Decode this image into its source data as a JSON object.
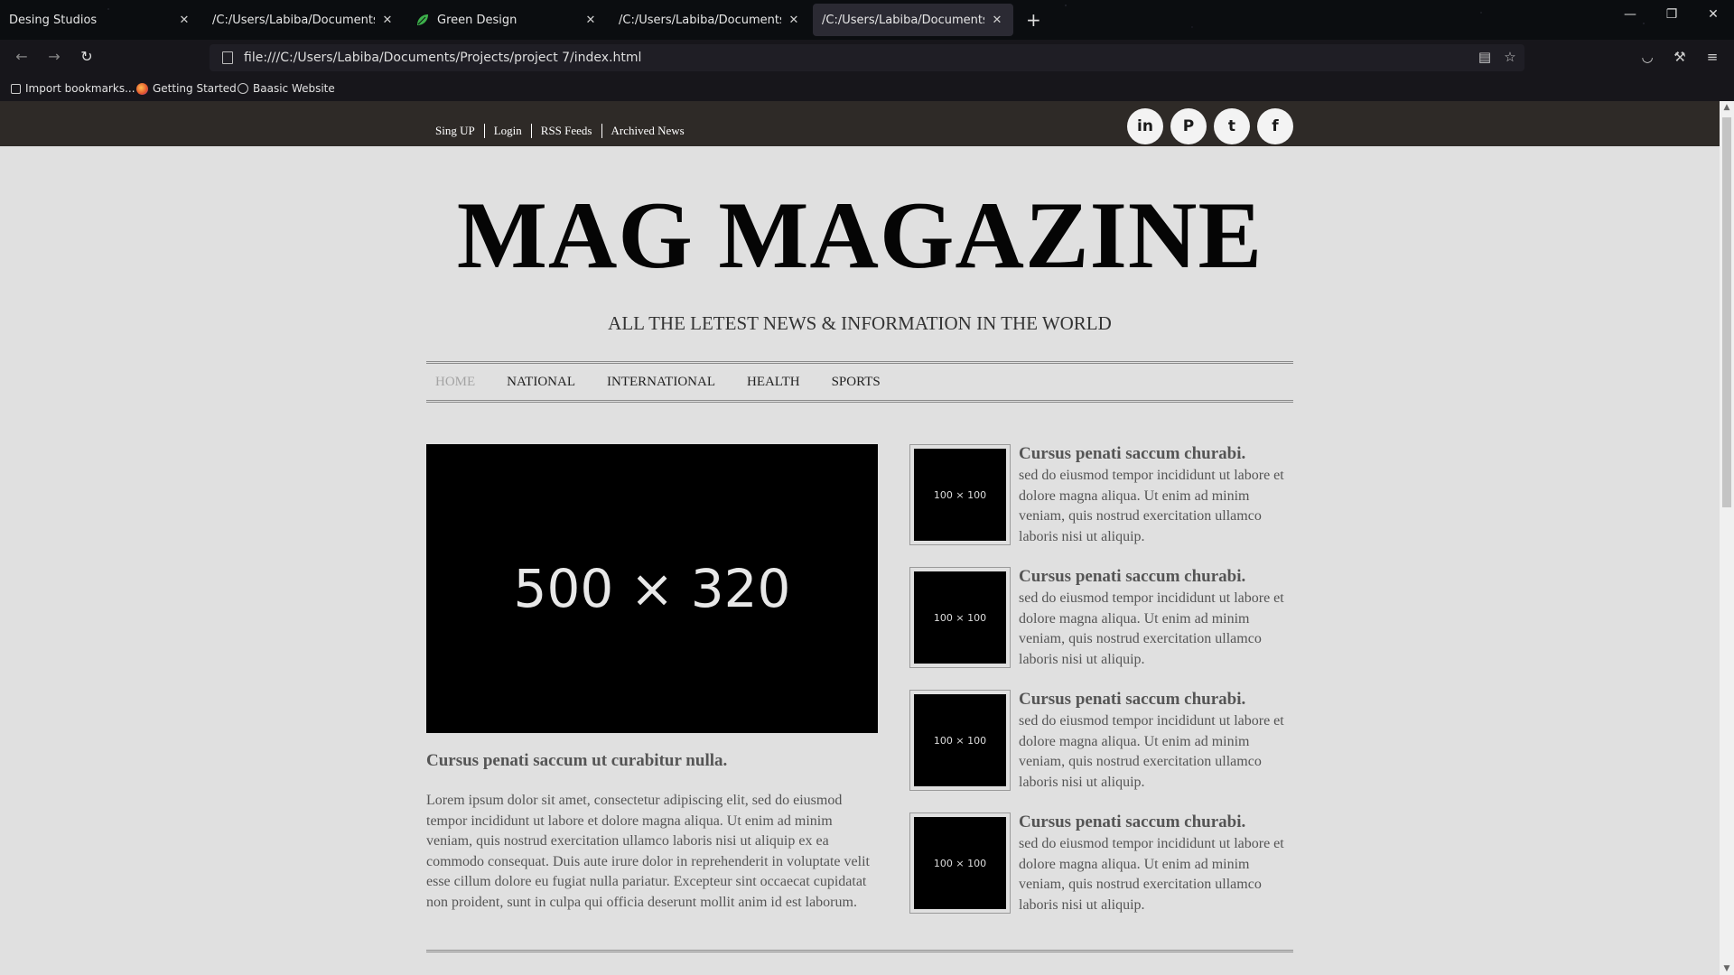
{
  "browser": {
    "tabs": [
      {
        "title": "Desing Studios"
      },
      {
        "title": "/C:/Users/Labiba/Documents/Proje"
      },
      {
        "title": "Green Design"
      },
      {
        "title": "/C:/Users/Labiba/Documents/Proje"
      },
      {
        "title": "/C:/Users/Labiba/Documents/Proje"
      }
    ],
    "url": "file:///C:/Users/Labiba/Documents/Projects/project 7/index.html",
    "bookmarks": [
      {
        "label": "Import bookmarks..."
      },
      {
        "label": "Getting Started"
      },
      {
        "label": "Baasic Website"
      }
    ]
  },
  "site": {
    "top_links": [
      "Sing UP",
      "Login",
      "RSS Feeds",
      "Archived News"
    ],
    "social": [
      {
        "icon": "linkedin-icon",
        "glyph": "in"
      },
      {
        "icon": "pinterest-icon",
        "glyph": "P"
      },
      {
        "icon": "tumblr-icon",
        "glyph": "t"
      },
      {
        "icon": "facebook-icon",
        "glyph": "f"
      }
    ],
    "logo": "MAG MAGAZINE",
    "tagline": "ALL THE LETEST NEWS & INFORMATION IN THE WORLD",
    "menu": [
      "HOME",
      "NATIONAL",
      "INTERNATIONAL",
      "HEALTH",
      "SPORTS"
    ],
    "hero": {
      "placeholder": "500 × 320",
      "title": "Cursus penati saccum ut curabitur nulla.",
      "text": "Lorem ipsum dolor sit amet, consectetur adipiscing elit, sed do eiusmod tempor incididunt ut labore et dolore magna aliqua. Ut enim ad minim veniam, quis nostrud exercitation ullamco laboris nisi ut aliquip ex ea commodo consequat. Duis aute irure dolor in reprehenderit in voluptate velit esse cillum dolore eu fugiat nulla pariatur. Excepteur sint occaecat cupidatat non proident, sunt in culpa qui officia deserunt mollit anim id est laborum."
    },
    "side_posts": [
      {
        "placeholder": "100 × 100",
        "title": "Cursus penati saccum churabi.",
        "text": "sed do eiusmod tempor incididunt ut labore et dolore magna aliqua. Ut enim ad minim veniam, quis nostrud exercitation ullamco laboris nisi ut aliquip."
      },
      {
        "placeholder": "100 × 100",
        "title": "Cursus penati saccum churabi.",
        "text": "sed do eiusmod tempor incididunt ut labore et dolore magna aliqua. Ut enim ad minim veniam, quis nostrud exercitation ullamco laboris nisi ut aliquip."
      },
      {
        "placeholder": "100 × 100",
        "title": "Cursus penati saccum churabi.",
        "text": "sed do eiusmod tempor incididunt ut labore et dolore magna aliqua. Ut enim ad minim veniam, quis nostrud exercitation ullamco laboris nisi ut aliquip."
      },
      {
        "placeholder": "100 × 100",
        "title": "Cursus penati saccum churabi.",
        "text": "sed do eiusmod tempor incididunt ut labore et dolore magna aliqua. Ut enim ad minim veniam, quis nostrud exercitation ullamco laboris nisi ut aliquip."
      }
    ]
  }
}
